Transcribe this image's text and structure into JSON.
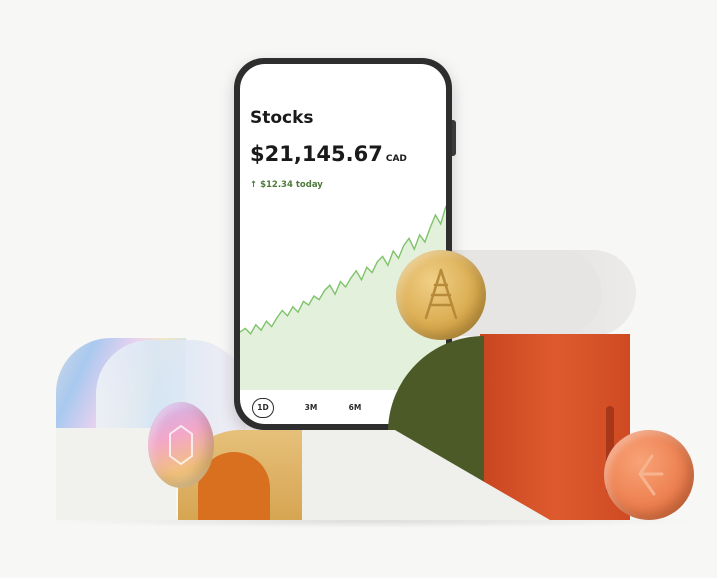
{
  "app": {
    "screen_title": "Stocks",
    "balance": "$21,145.67",
    "currency": "CAD",
    "change": "↑ $12.34 today",
    "ranges": [
      "1D",
      "3M",
      "6M"
    ],
    "active_range": "1D"
  },
  "colors": {
    "accent_green": "#4f7a3c",
    "chart_line": "#7fc36a",
    "chart_fill": "#e3f1dc"
  },
  "chart_data": {
    "type": "area",
    "x": [
      0,
      1,
      2,
      3,
      4,
      5,
      6,
      7,
      8,
      9,
      10,
      11,
      12,
      13,
      14,
      15,
      16,
      17,
      18,
      19,
      20,
      21,
      22,
      23,
      24,
      25,
      26,
      27,
      28,
      29,
      30,
      31,
      32,
      33,
      34,
      35,
      36,
      37,
      38,
      39
    ],
    "values": [
      10,
      12,
      9,
      14,
      11,
      16,
      13,
      18,
      22,
      19,
      24,
      21,
      27,
      25,
      30,
      28,
      33,
      36,
      31,
      38,
      35,
      40,
      44,
      39,
      46,
      43,
      49,
      52,
      47,
      55,
      51,
      58,
      62,
      56,
      64,
      60,
      68,
      75,
      70,
      80
    ],
    "ylim": [
      0,
      100
    ],
    "grid": false
  }
}
